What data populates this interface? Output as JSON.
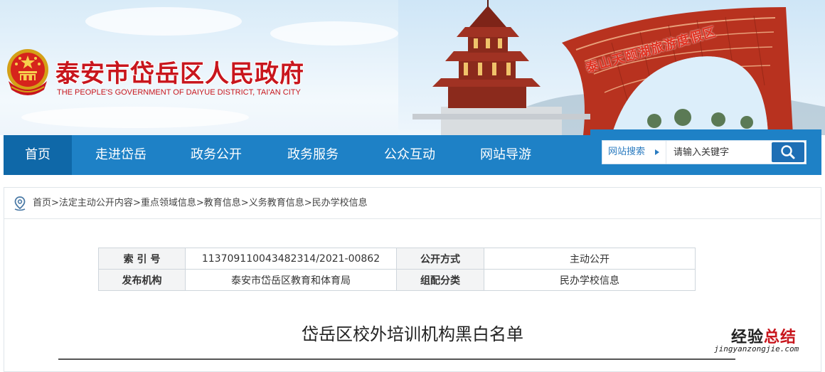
{
  "header": {
    "title": "泰安市岱岳区人民政府",
    "subtitle": "THE PEOPLE'S GOVERNMENT OF DAIYUE DISTRICT, TAI'AN CITY",
    "arch_sign": "泰山天颐湖旅游度假区"
  },
  "nav": {
    "items": [
      {
        "label": "首页",
        "active": true
      },
      {
        "label": "走进岱岳"
      },
      {
        "label": "政务公开"
      },
      {
        "label": "政务服务"
      },
      {
        "label": "公众互动"
      },
      {
        "label": "网站导游"
      }
    ]
  },
  "search": {
    "scope_label": "网站搜索",
    "placeholder": "请输入关键字",
    "button_icon": "search-icon"
  },
  "breadcrumb": {
    "icon": "location-pin-icon",
    "items": [
      "首页",
      "法定主动公开内容",
      "重点领域信息",
      "教育信息",
      "义务教育信息",
      "民办学校信息"
    ],
    "separator": ">"
  },
  "meta": {
    "index_label": "索 引 号",
    "index_value": "113709110043482314/2021-00862",
    "disclosure_label": "公开方式",
    "disclosure_value": "主动公开",
    "publisher_label": "发布机构",
    "publisher_value": "泰安市岱岳区教育和体育局",
    "category_label": "组配分类",
    "category_value": "民办学校信息"
  },
  "article": {
    "title": "岱岳区校外培训机构黑白名单"
  },
  "watermark": {
    "text_main": "经验",
    "text_accent": "总结",
    "url": "jingyanzongjie.com"
  },
  "colors": {
    "nav_bg": "#1e81c6",
    "nav_active": "#0f68a8",
    "title_red": "#c8161d"
  }
}
